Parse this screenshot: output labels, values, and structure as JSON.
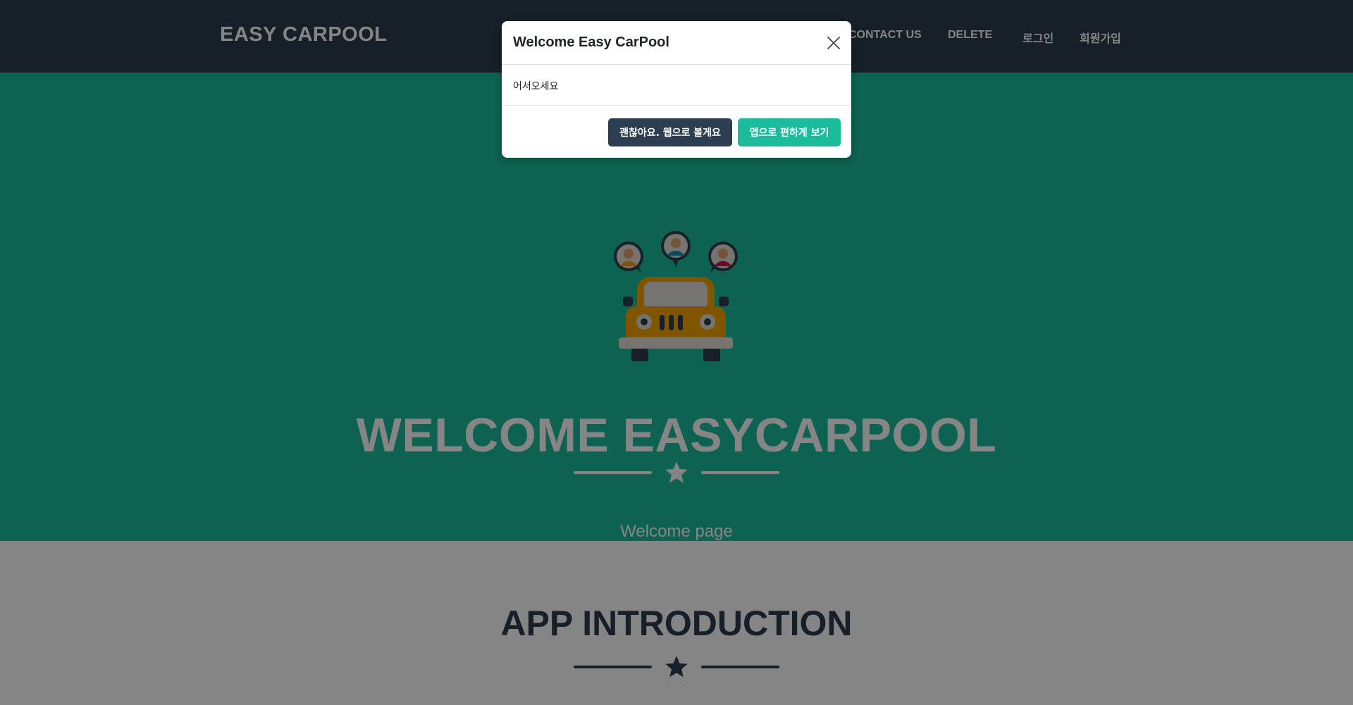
{
  "navbar": {
    "brand": "EASY CARPOOL",
    "links": [
      "CONTACT US",
      "DELETE",
      "로그인",
      "회원가입"
    ]
  },
  "masthead": {
    "image": "carpool-car-with-passengers-illustration",
    "title": "WELCOME EASYCARPOOL",
    "subtitle": "Welcome page",
    "divider_icon": "star-icon"
  },
  "section": {
    "title": "APP INTRODUCTION",
    "divider_icon": "star-icon"
  },
  "modal": {
    "title": "Welcome Easy CarPool",
    "body": "어서오세요",
    "close_icon": "close-icon",
    "buttons": {
      "web": "괜찮아요. 웹으로 볼게요",
      "app": "앱으로 편하게 보기"
    }
  },
  "colors": {
    "navbar_bg": "#2c3e50",
    "primary": "#1abc9c",
    "secondary": "#2c3e50",
    "white": "#ffffff",
    "backdrop": "rgba(0,0,0,0.48)"
  }
}
